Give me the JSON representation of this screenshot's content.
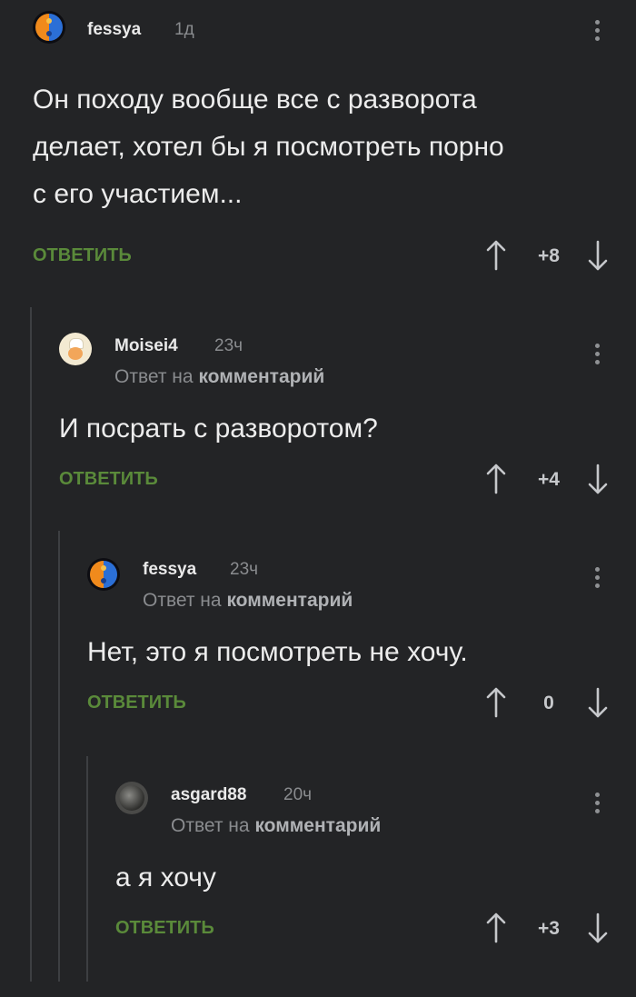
{
  "comments": [
    {
      "username": "fessya",
      "time": "1д",
      "reply_prefix": "",
      "reply_target": "",
      "text_lines": [
        "Он походу вообще все с разворота",
        "делает, хотел бы я посмотреть порно",
        "с его участием..."
      ],
      "reply_label": "ОТВЕТИТЬ",
      "score": "+8",
      "avatar": "yin-yang-avatar"
    },
    {
      "username": "Moisei4",
      "time": "23ч",
      "reply_prefix": "Ответ на",
      "reply_target": "комментарий",
      "text_lines": [
        "И посрать с разворотом?"
      ],
      "reply_label": "ОТВЕТИТЬ",
      "score": "+4",
      "avatar": "chef-avatar"
    },
    {
      "username": "fessya",
      "time": "23ч",
      "reply_prefix": "Ответ на",
      "reply_target": "комментарий",
      "text_lines": [
        "Нет, это я посмотреть не хочу."
      ],
      "reply_label": "ОТВЕТИТЬ",
      "score": "0",
      "avatar": "yin-yang-avatar"
    },
    {
      "username": "asgard88",
      "time": "20ч",
      "reply_prefix": "Ответ на",
      "reply_target": "комментарий",
      "text_lines": [
        "а я хочу"
      ],
      "reply_label": "ОТВЕТИТЬ",
      "score": "+3",
      "avatar": "cat-avatar"
    }
  ],
  "colors": {
    "background": "#232426",
    "reply_button": "#5a8a3a",
    "muted_text": "#8a8c8f",
    "thread_line": "#3d3f42"
  },
  "icons": {
    "more": "kebab-menu-icon",
    "upvote": "arrow-up-icon",
    "downvote": "arrow-down-icon"
  }
}
